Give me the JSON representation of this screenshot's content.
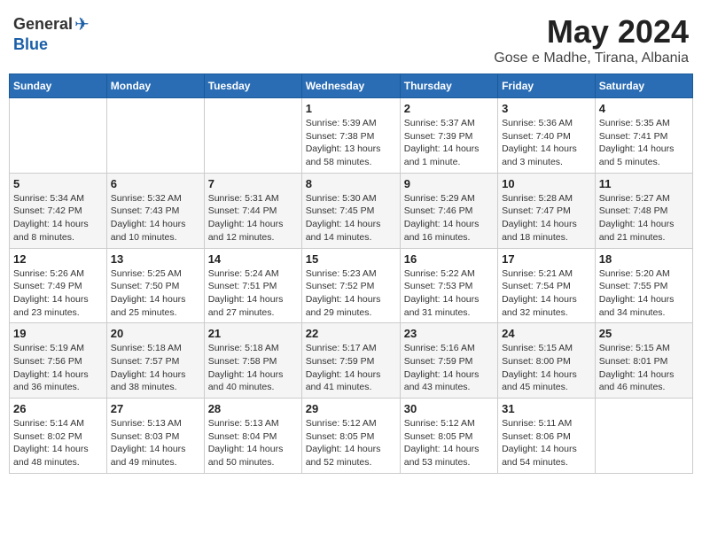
{
  "logo": {
    "general": "General",
    "blue": "Blue"
  },
  "title": {
    "month_year": "May 2024",
    "location": "Gose e Madhe, Tirana, Albania"
  },
  "days_of_week": [
    "Sunday",
    "Monday",
    "Tuesday",
    "Wednesday",
    "Thursday",
    "Friday",
    "Saturday"
  ],
  "weeks": [
    [
      {
        "day": "",
        "info": ""
      },
      {
        "day": "",
        "info": ""
      },
      {
        "day": "",
        "info": ""
      },
      {
        "day": "1",
        "info": "Sunrise: 5:39 AM\nSunset: 7:38 PM\nDaylight: 13 hours and 58 minutes."
      },
      {
        "day": "2",
        "info": "Sunrise: 5:37 AM\nSunset: 7:39 PM\nDaylight: 14 hours and 1 minute."
      },
      {
        "day": "3",
        "info": "Sunrise: 5:36 AM\nSunset: 7:40 PM\nDaylight: 14 hours and 3 minutes."
      },
      {
        "day": "4",
        "info": "Sunrise: 5:35 AM\nSunset: 7:41 PM\nDaylight: 14 hours and 5 minutes."
      }
    ],
    [
      {
        "day": "5",
        "info": "Sunrise: 5:34 AM\nSunset: 7:42 PM\nDaylight: 14 hours and 8 minutes."
      },
      {
        "day": "6",
        "info": "Sunrise: 5:32 AM\nSunset: 7:43 PM\nDaylight: 14 hours and 10 minutes."
      },
      {
        "day": "7",
        "info": "Sunrise: 5:31 AM\nSunset: 7:44 PM\nDaylight: 14 hours and 12 minutes."
      },
      {
        "day": "8",
        "info": "Sunrise: 5:30 AM\nSunset: 7:45 PM\nDaylight: 14 hours and 14 minutes."
      },
      {
        "day": "9",
        "info": "Sunrise: 5:29 AM\nSunset: 7:46 PM\nDaylight: 14 hours and 16 minutes."
      },
      {
        "day": "10",
        "info": "Sunrise: 5:28 AM\nSunset: 7:47 PM\nDaylight: 14 hours and 18 minutes."
      },
      {
        "day": "11",
        "info": "Sunrise: 5:27 AM\nSunset: 7:48 PM\nDaylight: 14 hours and 21 minutes."
      }
    ],
    [
      {
        "day": "12",
        "info": "Sunrise: 5:26 AM\nSunset: 7:49 PM\nDaylight: 14 hours and 23 minutes."
      },
      {
        "day": "13",
        "info": "Sunrise: 5:25 AM\nSunset: 7:50 PM\nDaylight: 14 hours and 25 minutes."
      },
      {
        "day": "14",
        "info": "Sunrise: 5:24 AM\nSunset: 7:51 PM\nDaylight: 14 hours and 27 minutes."
      },
      {
        "day": "15",
        "info": "Sunrise: 5:23 AM\nSunset: 7:52 PM\nDaylight: 14 hours and 29 minutes."
      },
      {
        "day": "16",
        "info": "Sunrise: 5:22 AM\nSunset: 7:53 PM\nDaylight: 14 hours and 31 minutes."
      },
      {
        "day": "17",
        "info": "Sunrise: 5:21 AM\nSunset: 7:54 PM\nDaylight: 14 hours and 32 minutes."
      },
      {
        "day": "18",
        "info": "Sunrise: 5:20 AM\nSunset: 7:55 PM\nDaylight: 14 hours and 34 minutes."
      }
    ],
    [
      {
        "day": "19",
        "info": "Sunrise: 5:19 AM\nSunset: 7:56 PM\nDaylight: 14 hours and 36 minutes."
      },
      {
        "day": "20",
        "info": "Sunrise: 5:18 AM\nSunset: 7:57 PM\nDaylight: 14 hours and 38 minutes."
      },
      {
        "day": "21",
        "info": "Sunrise: 5:18 AM\nSunset: 7:58 PM\nDaylight: 14 hours and 40 minutes."
      },
      {
        "day": "22",
        "info": "Sunrise: 5:17 AM\nSunset: 7:59 PM\nDaylight: 14 hours and 41 minutes."
      },
      {
        "day": "23",
        "info": "Sunrise: 5:16 AM\nSunset: 7:59 PM\nDaylight: 14 hours and 43 minutes."
      },
      {
        "day": "24",
        "info": "Sunrise: 5:15 AM\nSunset: 8:00 PM\nDaylight: 14 hours and 45 minutes."
      },
      {
        "day": "25",
        "info": "Sunrise: 5:15 AM\nSunset: 8:01 PM\nDaylight: 14 hours and 46 minutes."
      }
    ],
    [
      {
        "day": "26",
        "info": "Sunrise: 5:14 AM\nSunset: 8:02 PM\nDaylight: 14 hours and 48 minutes."
      },
      {
        "day": "27",
        "info": "Sunrise: 5:13 AM\nSunset: 8:03 PM\nDaylight: 14 hours and 49 minutes."
      },
      {
        "day": "28",
        "info": "Sunrise: 5:13 AM\nSunset: 8:04 PM\nDaylight: 14 hours and 50 minutes."
      },
      {
        "day": "29",
        "info": "Sunrise: 5:12 AM\nSunset: 8:05 PM\nDaylight: 14 hours and 52 minutes."
      },
      {
        "day": "30",
        "info": "Sunrise: 5:12 AM\nSunset: 8:05 PM\nDaylight: 14 hours and 53 minutes."
      },
      {
        "day": "31",
        "info": "Sunrise: 5:11 AM\nSunset: 8:06 PM\nDaylight: 14 hours and 54 minutes."
      },
      {
        "day": "",
        "info": ""
      }
    ]
  ]
}
